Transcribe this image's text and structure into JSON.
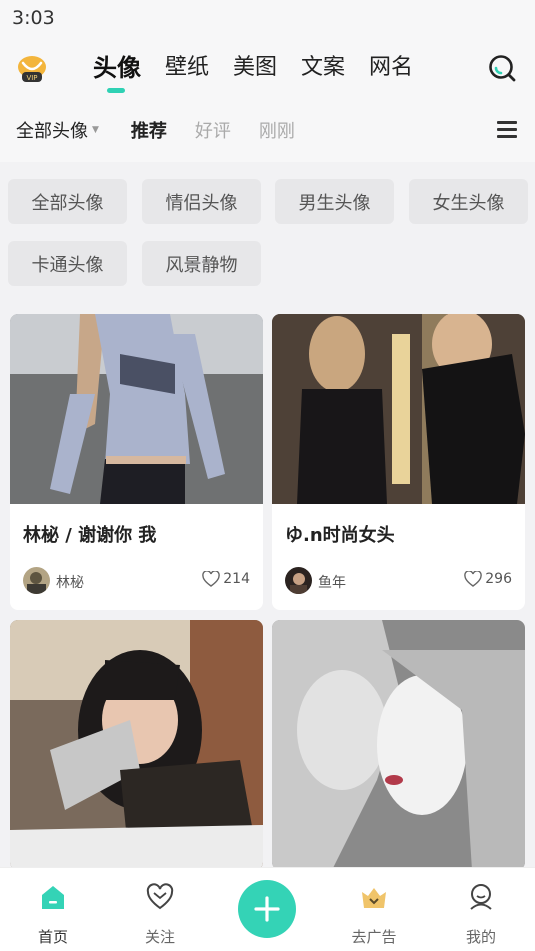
{
  "status_bar": {
    "time": "3:03"
  },
  "header": {
    "vip_badge": "VIP",
    "main_tabs": [
      {
        "label": "头像",
        "active": true
      },
      {
        "label": "壁纸",
        "active": false
      },
      {
        "label": "美图",
        "active": false
      },
      {
        "label": "文案",
        "active": false
      },
      {
        "label": "网名",
        "active": false
      }
    ],
    "sub_tabs": [
      {
        "label": "全部头像"
      },
      {
        "label": "推荐"
      },
      {
        "label": "好评"
      },
      {
        "label": "刚刚"
      }
    ]
  },
  "categories": [
    "全部头像",
    "情侣头像",
    "男生头像",
    "女生头像",
    "卡通头像",
    "风景静物"
  ],
  "feed": [
    {
      "title": "林柲 / 谢谢你 我",
      "author": "林柲",
      "likes": "214"
    },
    {
      "title": "ゆ.n时尚女头",
      "author": "鱼年",
      "likes": "296"
    },
    {
      "title": "",
      "author": "",
      "likes": ""
    },
    {
      "title": "",
      "author": "",
      "likes": ""
    }
  ],
  "bottom_nav": [
    {
      "label": "首页",
      "icon": "home-icon",
      "active": true
    },
    {
      "label": "关注",
      "icon": "heart-icon",
      "active": false
    },
    {
      "label": "",
      "icon": "plus-icon",
      "active": false
    },
    {
      "label": "去广告",
      "icon": "crown-icon",
      "active": false
    },
    {
      "label": "我的",
      "icon": "profile-icon",
      "active": false
    }
  ],
  "colors": {
    "accent": "#34d3b6",
    "background": "#f2f2f4",
    "chip": "#e7e7e9"
  }
}
